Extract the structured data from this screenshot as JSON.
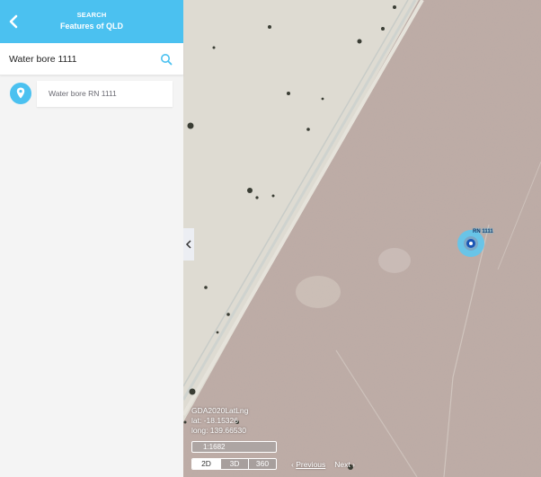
{
  "header": {
    "subtitle": "SEARCH",
    "title": "Features of QLD",
    "back_icon": "chevron-left-icon"
  },
  "search": {
    "value": "Water bore 1111",
    "placeholder": "",
    "icon": "search-icon"
  },
  "results": [
    {
      "label": "Water bore RN 1111",
      "icon": "map-pin-icon"
    }
  ],
  "map": {
    "collapse_icon": "chevron-left-icon",
    "marker_label": "RN 1111",
    "coordinates": {
      "system": "GDA2020LatLng",
      "lat_label": "lat: -18.15326",
      "long_label": "long: 139.66530"
    },
    "scale": "1:1682",
    "view_modes": [
      {
        "label": "2D",
        "active": true
      },
      {
        "label": "3D",
        "active": false
      },
      {
        "label": "360",
        "active": false
      }
    ],
    "pager": {
      "previous": "Previous",
      "next": "Next"
    }
  },
  "colors": {
    "accent": "#4bc1f0",
    "marker_core": "#1a55b5"
  }
}
